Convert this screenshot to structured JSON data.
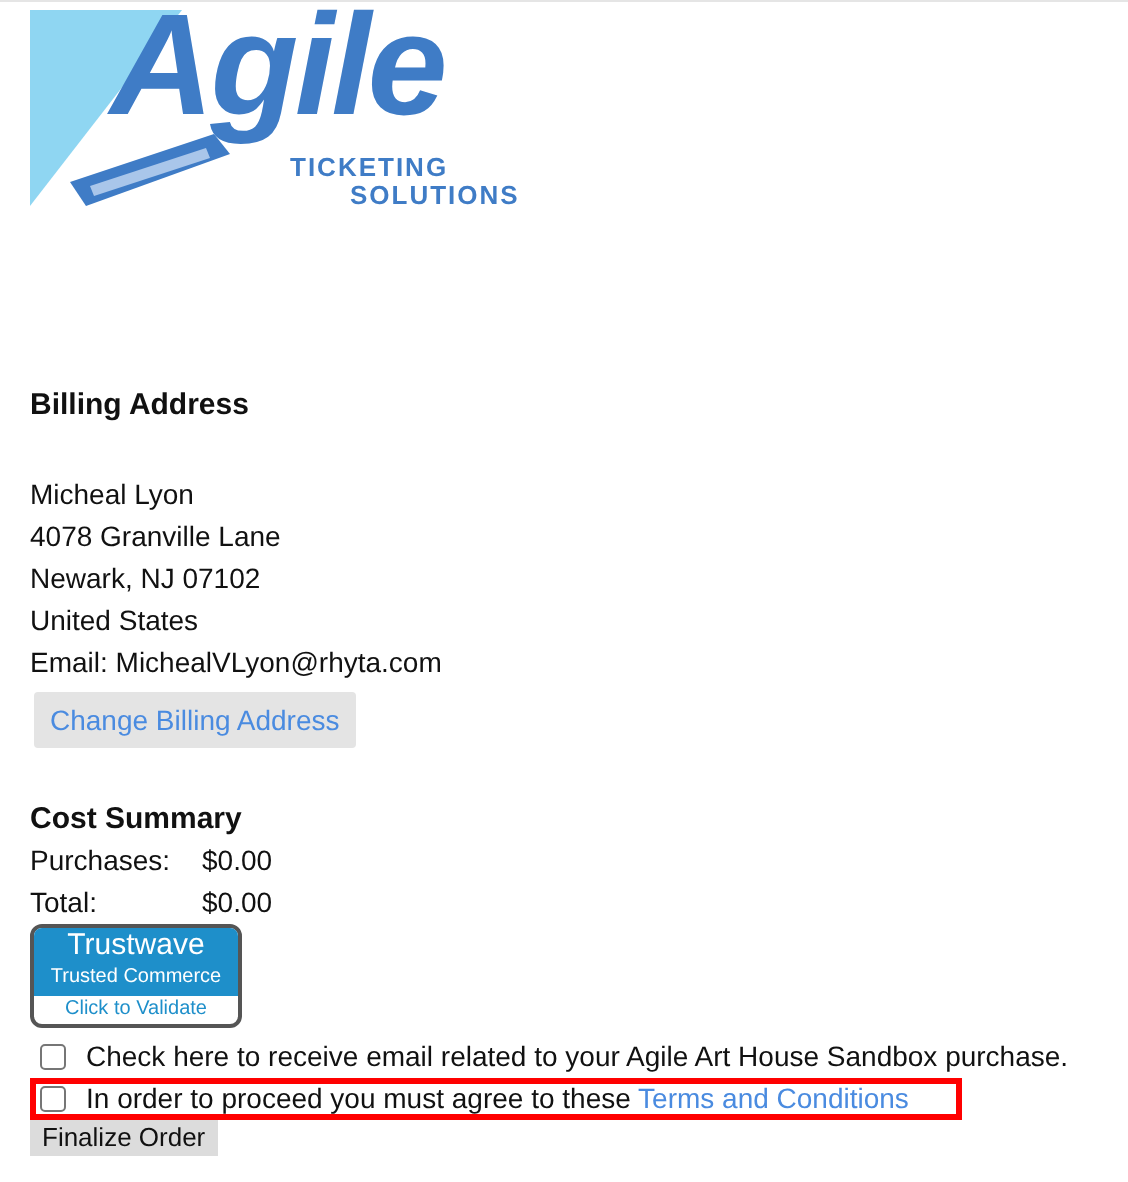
{
  "logo": {
    "word": "Agile",
    "line_1": "TICKETING",
    "line_2": "SOLUTIONS"
  },
  "billing": {
    "heading": "Billing Address",
    "lines": [
      "Micheal Lyon",
      "4078 Granville Lane",
      "Newark, NJ 07102",
      "United States",
      "Email: MichealVLyon@rhyta.com"
    ],
    "button": "Change Billing Address"
  },
  "cost_summary": {
    "heading": "Cost Summary",
    "rows": [
      {
        "label": "Purchases:",
        "value": "$0.00"
      },
      {
        "label": "Total:",
        "value": "$0.00"
      }
    ]
  },
  "seal": {
    "brand": "Trustwave",
    "line": "Trusted Commerce",
    "action": "Click to Validate"
  },
  "options": [
    {
      "text": "Check here to receive email related to your Agile Art House Sandbox purchase.",
      "checked": false,
      "highlighted": false
    },
    {
      "text": "In order to proceed you must agree to these ",
      "link": "Terms and Conditions",
      "checked": false,
      "highlighted": true
    }
  ],
  "submit": "Finalize Order"
}
